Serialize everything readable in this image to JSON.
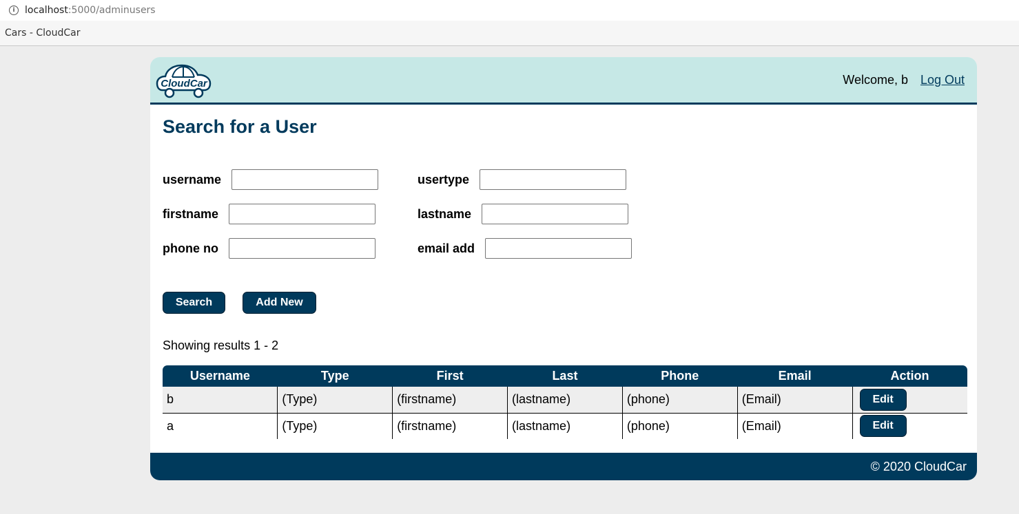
{
  "browser": {
    "url_host": "localhost",
    "url_path": ":5000/adminusers",
    "tab_title": "Cars - CloudCar"
  },
  "header": {
    "logo_text": "CloudCar",
    "welcome": "Welcome, b",
    "logout_label": "Log Out"
  },
  "page_title": "Search for a User",
  "form": {
    "username_label": "username",
    "usertype_label": "usertype",
    "firstname_label": "firstname",
    "lastname_label": "lastname",
    "phone_label": "phone no",
    "email_label": "email add",
    "username_value": "",
    "usertype_value": "",
    "firstname_value": "",
    "lastname_value": "",
    "phone_value": "",
    "email_value": ""
  },
  "buttons": {
    "search_label": "Search",
    "add_new_label": "Add New"
  },
  "results": {
    "summary": "Showing results 1 - 2",
    "columns": [
      "Username",
      "Type",
      "First",
      "Last",
      "Phone",
      "Email",
      "Action"
    ],
    "rows": [
      {
        "username": "b",
        "type": "(Type)",
        "first": "(firstname)",
        "last": "(lastname)",
        "phone": "(phone)",
        "email": "(Email)",
        "action": "Edit"
      },
      {
        "username": "a",
        "type": "(Type)",
        "first": "(firstname)",
        "last": "(lastname)",
        "phone": "(phone)",
        "email": "(Email)",
        "action": "Edit"
      }
    ]
  },
  "footer": {
    "copyright": "© 2020 CloudCar"
  },
  "colors": {
    "brand_navy": "#003a5c",
    "header_bg": "#c6e8e6",
    "page_bg": "#ededed"
  },
  "icons": {
    "site_info": "info-circle-icon",
    "logo": "cloudcar-logo"
  }
}
